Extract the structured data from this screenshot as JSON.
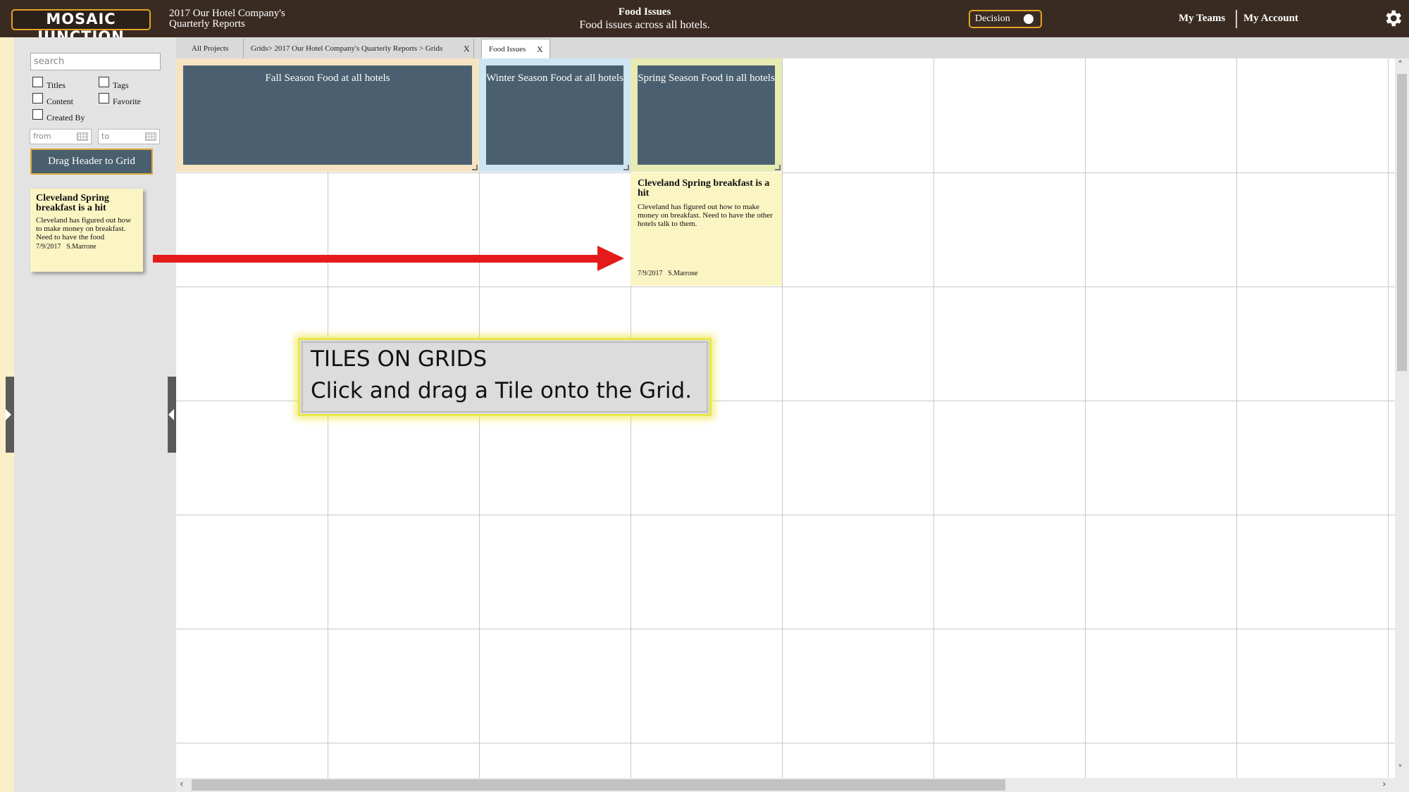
{
  "header": {
    "logo_text": "MOSAIC JUNCTION",
    "project_title": "2017 Our Hotel Company's Quarterly Reports",
    "page_title": "Food Issues",
    "page_subtitle": "Food issues across all hotels.",
    "decision_label": "Decision",
    "my_teams": "My Teams",
    "my_account": "My Account",
    "settings_icon": "gear-icon"
  },
  "sidebar": {
    "search_placeholder": "search",
    "filters": {
      "titles": "Titles",
      "tags": "Tags",
      "content": "Content",
      "favorite": "Favorite",
      "created_by": "Created By"
    },
    "date_from": "from",
    "date_to": "to",
    "drag_header_button": "Drag Header to Grid",
    "tile": {
      "title": "Cleveland Spring breakfast is a hit",
      "body": "Cleveland has figured out how to make money on breakfast. Need to have the food",
      "date": "7/9/2017",
      "author": "S.Marrone"
    }
  },
  "tabs": {
    "all_projects": "All Projects",
    "breadcrumb": "Grids>    2017 Our Hotel Company's Quarterly Reports > Grids",
    "active": "Food Issues",
    "close": "X"
  },
  "grid": {
    "headers": [
      {
        "label": "Fall Season Food at all hotels",
        "color": "#f6e3c2"
      },
      {
        "label": "Winter Season Food at all hotels",
        "color": "#cde6f2"
      },
      {
        "label": "Spring Season Food in all hotels",
        "color": "#e7ebb3"
      }
    ],
    "tile": {
      "title": "Cleveland Spring breakfast is a hit",
      "body": "Cleveland has figured out how to make money on breakfast. Need to have the other hotels talk to them.",
      "date": "7/9/2017",
      "author": "S.Marrone"
    }
  },
  "callout": {
    "line1": "TILES ON GRIDS",
    "line2": "Click and drag a Tile onto the Grid."
  },
  "colors": {
    "topbar": "#3a2b22",
    "accent": "#e3a324",
    "header_tile": "#4a6070",
    "tile_bg": "#fbf5c4",
    "arrow": "#e51a1a"
  }
}
